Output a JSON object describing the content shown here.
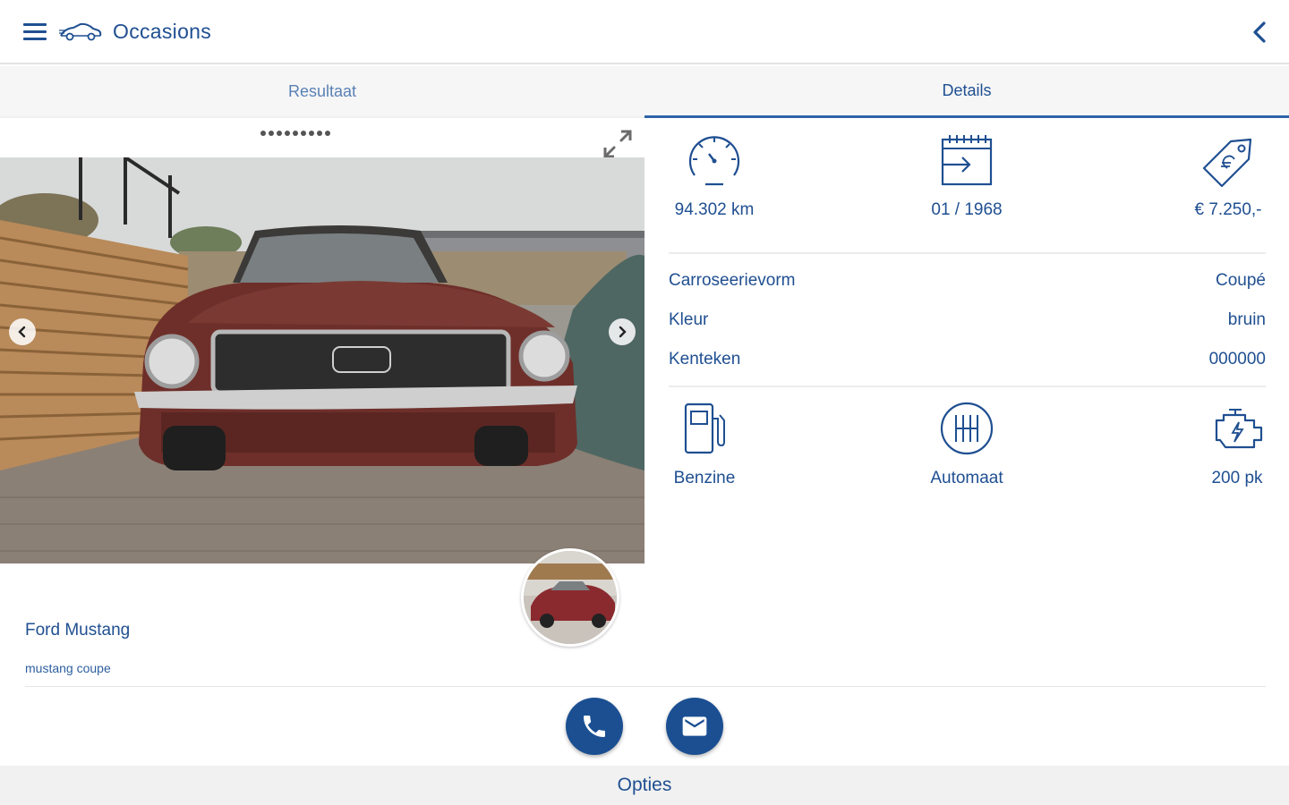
{
  "header": {
    "title": "Occasions",
    "menu_icon": "hamburger-menu-icon",
    "logo_icon": "car-logo-icon",
    "back_icon": "chevron-left-icon"
  },
  "tabs": [
    {
      "label": "Resultaat",
      "active": false
    },
    {
      "label": "Details",
      "active": true
    }
  ],
  "gallery": {
    "image_count": 9,
    "expand_icon": "expand-icon",
    "favorite_icon": "star-icon"
  },
  "car": {
    "name": "Ford Mustang",
    "subtitle": "mustang coupe"
  },
  "stats": {
    "mileage": "94.302 km",
    "registration": "01 / 1968",
    "price": "€ 7.250,-"
  },
  "specs": [
    {
      "label": "Carroseerievorm",
      "value": "Coupé"
    },
    {
      "label": "Kleur",
      "value": "bruin"
    },
    {
      "label": "Kenteken",
      "value": "000000"
    }
  ],
  "engine": {
    "fuel": "Benzine",
    "transmission": "Automaat",
    "power": "200 pk"
  },
  "actions": {
    "call_icon": "phone-icon",
    "mail_icon": "mail-icon"
  },
  "footer": {
    "label": "Opties"
  },
  "colors": {
    "primary": "#1f4f91",
    "button": "#1b4f92",
    "tab_indicator": "#2f63aa"
  }
}
